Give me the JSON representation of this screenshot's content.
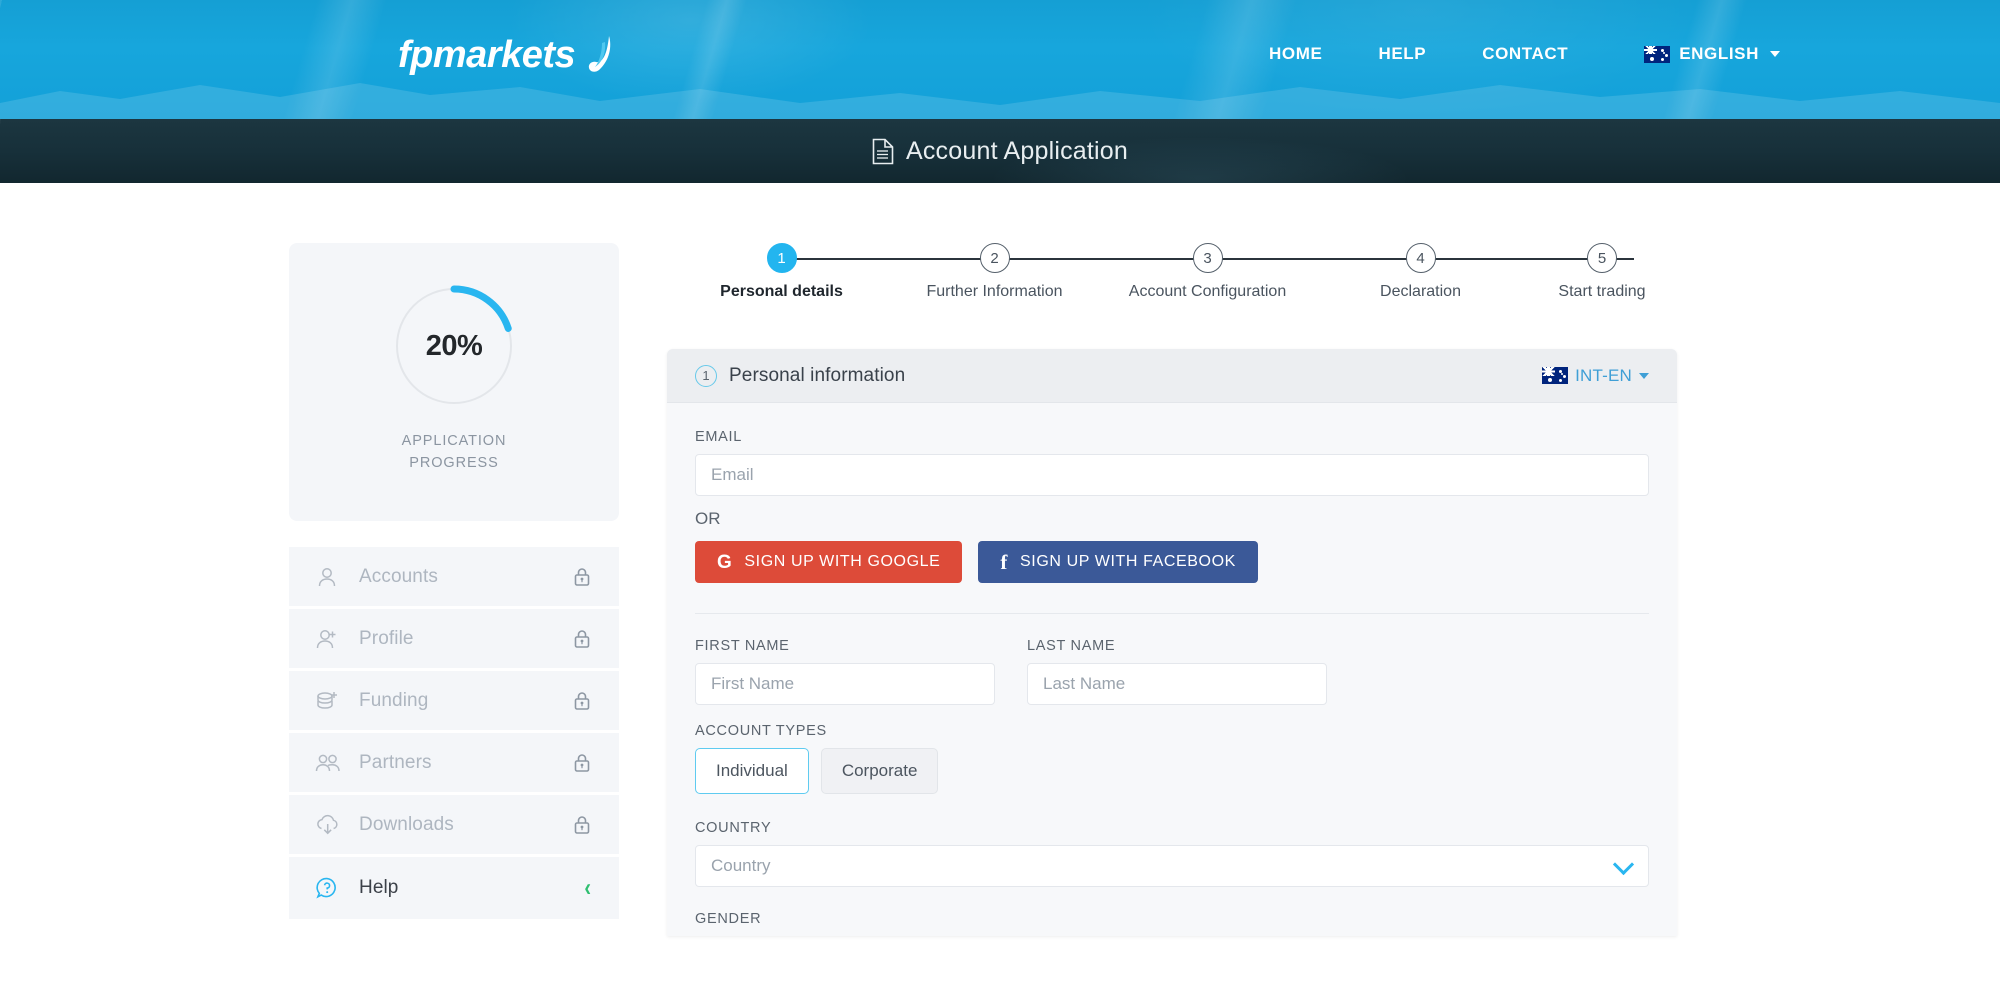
{
  "header": {
    "logo_text": "fpmarkets",
    "nav": [
      {
        "label": "HOME"
      },
      {
        "label": "HELP"
      },
      {
        "label": "CONTACT"
      }
    ],
    "language": {
      "label": "ENGLISH",
      "flag": "australia-flag-icon",
      "caret": "chevron-down-icon"
    }
  },
  "banner": {
    "icon": "document-icon",
    "title": "Account Application"
  },
  "sidebar": {
    "progress": {
      "percent_label": "20%",
      "percent_value": 20,
      "caption_line1": "APPLICATION",
      "caption_line2": "PROGRESS",
      "arc_color": "#29b6f0",
      "track_color": "#e3e6ea"
    },
    "items": [
      {
        "label": "Accounts",
        "icon": "user-icon",
        "right_icon": "lock-icon",
        "locked": true,
        "active": false
      },
      {
        "label": "Profile",
        "icon": "user-plus-icon",
        "right_icon": "lock-icon",
        "locked": true,
        "active": false
      },
      {
        "label": "Funding",
        "icon": "coins-plus-icon",
        "right_icon": "lock-icon",
        "locked": true,
        "active": false
      },
      {
        "label": "Partners",
        "icon": "users-icon",
        "right_icon": "lock-icon",
        "locked": true,
        "active": false
      },
      {
        "label": "Downloads",
        "icon": "cloud-download-icon",
        "right_icon": "lock-icon",
        "locked": true,
        "active": false
      },
      {
        "label": "Help",
        "icon": "question-bubble-icon",
        "right_icon": "chevron-left-icon",
        "locked": false,
        "active": true
      }
    ]
  },
  "stepper": {
    "steps": [
      {
        "number": "1",
        "label": "Personal details",
        "active": true
      },
      {
        "number": "2",
        "label": "Further Information",
        "active": false
      },
      {
        "number": "3",
        "label": "Account Configuration",
        "active": false
      },
      {
        "number": "4",
        "label": "Declaration",
        "active": false
      },
      {
        "number": "5",
        "label": "Start trading",
        "active": false
      }
    ]
  },
  "form": {
    "card_header": {
      "number": "1",
      "title": "Personal information",
      "locale_label": "INT-EN",
      "locale_flag": "australia-flag-icon"
    },
    "email": {
      "label": "EMAIL",
      "placeholder": "Email",
      "value": ""
    },
    "or_text": "OR",
    "social": {
      "google": {
        "label": "SIGN UP WITH GOOGLE",
        "icon": "google-icon",
        "color": "#dd4b39"
      },
      "facebook": {
        "label": "SIGN UP WITH FACEBOOK",
        "icon": "facebook-icon",
        "color": "#3b5998"
      }
    },
    "first_name": {
      "label": "FIRST NAME",
      "placeholder": "First Name",
      "value": ""
    },
    "last_name": {
      "label": "LAST NAME",
      "placeholder": "Last Name",
      "value": ""
    },
    "account_types": {
      "label": "ACCOUNT TYPES",
      "options": [
        {
          "label": "Individual",
          "selected": true
        },
        {
          "label": "Corporate",
          "selected": false
        }
      ]
    },
    "country": {
      "label": "COUNTRY",
      "placeholder": "Country",
      "value": "",
      "caret": "chevron-down-icon"
    },
    "gender": {
      "label": "GENDER"
    }
  }
}
